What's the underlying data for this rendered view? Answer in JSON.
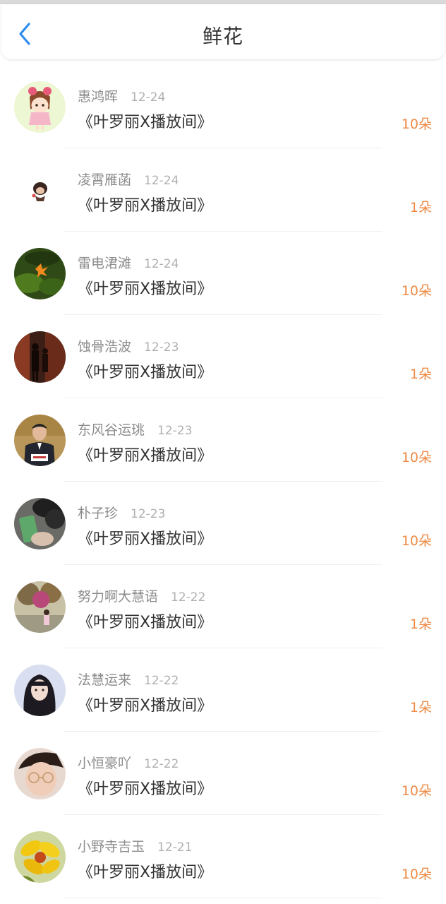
{
  "header": {
    "title": "鲜花",
    "back_icon": "chevron-left-icon",
    "accent_color": "#2d8cf0"
  },
  "list": {
    "count_color": "#ee8a45",
    "items": [
      {
        "name": "惠鸿晖",
        "date": "12-24",
        "room": "《叶罗丽X播放间》",
        "count": "10朵",
        "avatar": "cartoon-girl-avatar"
      },
      {
        "name": "凌霄雁菡",
        "date": "12-24",
        "room": "《叶罗丽X播放间》",
        "count": "1朵",
        "avatar": "small-character-avatar"
      },
      {
        "name": "雷电涒滩",
        "date": "12-24",
        "room": "《叶罗丽X播放间》",
        "count": "10朵",
        "avatar": "leaf-on-moss-avatar"
      },
      {
        "name": "蚀骨浩波",
        "date": "12-23",
        "room": "《叶罗丽X播放间》",
        "count": "1朵",
        "avatar": "silhouette-couple-avatar"
      },
      {
        "name": "东风谷运珧",
        "date": "12-23",
        "room": "《叶罗丽X播放间》",
        "count": "10朵",
        "avatar": "man-at-desk-avatar"
      },
      {
        "name": "朴子珍",
        "date": "12-23",
        "room": "《叶罗丽X播放间》",
        "count": "10朵",
        "avatar": "phone-in-hand-avatar"
      },
      {
        "name": "努力啊大慧语",
        "date": "12-22",
        "room": "《叶罗丽X播放间》",
        "count": "1朵",
        "avatar": "girl-under-tree-avatar"
      },
      {
        "name": "法慧运来",
        "date": "12-22",
        "room": "《叶罗丽X播放间》",
        "count": "1朵",
        "avatar": "girl-portrait-avatar"
      },
      {
        "name": "小恒豪吖",
        "date": "12-22",
        "room": "《叶罗丽X播放间》",
        "count": "10朵",
        "avatar": "boy-with-glasses-avatar"
      },
      {
        "name": "小野寺吉玉",
        "date": "12-21",
        "room": "《叶罗丽X播放间》",
        "count": "10朵",
        "avatar": "yellow-flower-avatar"
      }
    ]
  }
}
